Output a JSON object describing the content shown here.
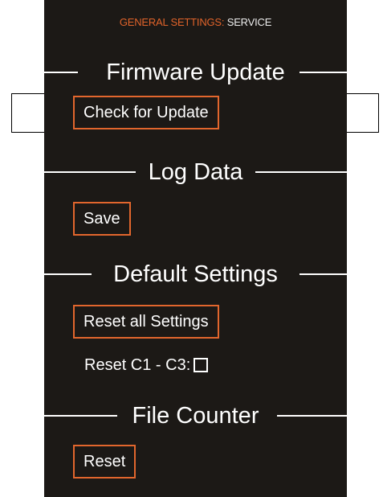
{
  "header": {
    "breadcrumb_parent": "GENERAL SETTINGS:",
    "breadcrumb_current": "SERVICE"
  },
  "firmware": {
    "title": "Firmware Update",
    "check_button": "Check for Update"
  },
  "log_data": {
    "title": "Log Data",
    "save_button": "Save"
  },
  "defaults": {
    "title": "Default Settings",
    "reset_all_button": "Reset all Settings",
    "reset_c1_c3_label": "Reset C1 - C3:",
    "reset_c1_c3_checked": false
  },
  "file_counter": {
    "title": "File Counter",
    "reset_button": "Reset"
  },
  "colors": {
    "background": "#1c1916",
    "accent": "#e2662d",
    "text": "#ffffff"
  }
}
